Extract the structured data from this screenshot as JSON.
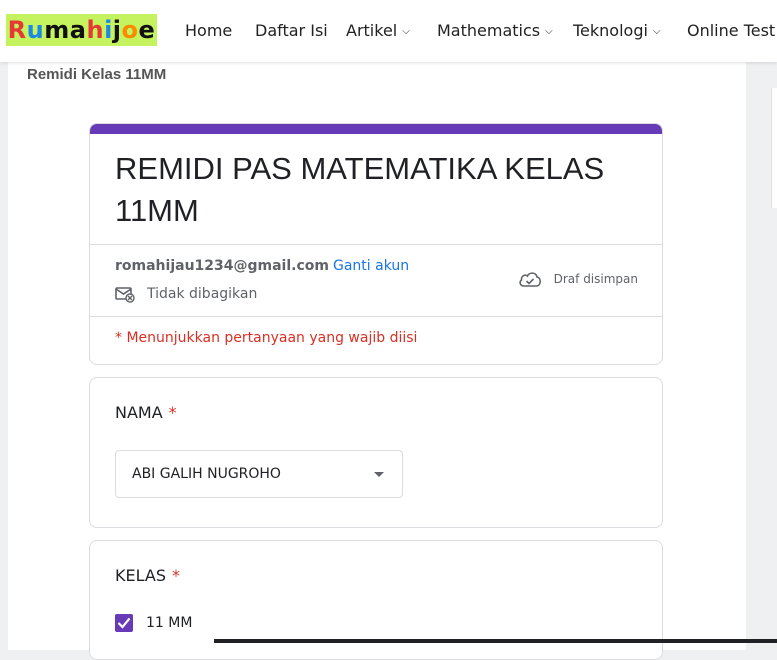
{
  "site": {
    "logo_letters": [
      {
        "char": "R",
        "color": "#e53935"
      },
      {
        "char": "u",
        "color": "#1e88e5"
      },
      {
        "char": "m",
        "color": "#111111"
      },
      {
        "char": "a",
        "color": "#111111"
      },
      {
        "char": "h",
        "color": "#e53935"
      },
      {
        "char": "i",
        "color": "#1e88e5"
      },
      {
        "char": "j",
        "color": "#111111"
      },
      {
        "char": "o",
        "color": "#fb8c00"
      },
      {
        "char": "e",
        "color": "#111111"
      }
    ],
    "logo_bg": "#c5f25f"
  },
  "nav": {
    "items": [
      {
        "label": "Home",
        "dropdown": false
      },
      {
        "label": "Daftar Isi",
        "dropdown": false
      },
      {
        "label": "Artikel",
        "dropdown": true
      },
      {
        "label": "Mathematics",
        "dropdown": true
      },
      {
        "label": "Teknologi",
        "dropdown": true
      },
      {
        "label": "Online Test",
        "dropdown": false
      }
    ],
    "caret_icon": "chevron-down-icon"
  },
  "post": {
    "title": "Remidi Kelas 11MM"
  },
  "form": {
    "accent_color": "#673ab7",
    "title": "REMIDI PAS MATEMATIKA KELAS 11MM",
    "account_email": "romahijau1234@gmail.com",
    "switch_account": "Ganti akun",
    "not_shared": "Tidak dibagikan",
    "not_shared_icon": "mail-off-icon",
    "draft_status": "Draf disimpan",
    "draft_icon": "cloud-check-icon",
    "required_note": "* Menunjukkan pertanyaan yang wajib diisi",
    "required_color": "#d93025",
    "questions": [
      {
        "label": "NAMA",
        "required_mark": "*",
        "type": "dropdown",
        "value": "ABI GALIH NUGROHO"
      },
      {
        "label": "KELAS",
        "required_mark": "*",
        "type": "checkbox",
        "options": [
          {
            "label": "11 MM",
            "checked": true
          }
        ]
      }
    ]
  }
}
